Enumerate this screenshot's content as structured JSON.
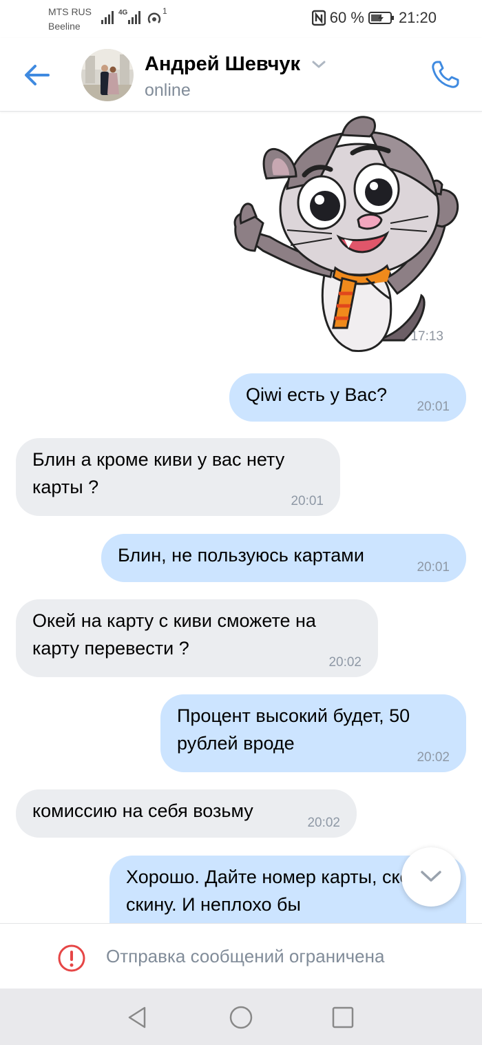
{
  "status_bar": {
    "carrier1": "MTS RUS",
    "carrier2": "Beeline",
    "network": "4G",
    "hotspot_count": "1",
    "battery": "60 %",
    "time": "21:20"
  },
  "header": {
    "name": "Андрей Шевчук",
    "status": "online"
  },
  "sticker": {
    "time": "17:13"
  },
  "messages": [
    {
      "direction": "out",
      "text": "Qiwi есть у Вас?",
      "time": "20:01"
    },
    {
      "direction": "in",
      "text": "Блин а кроме киви у вас нету карты ?",
      "time": "20:01"
    },
    {
      "direction": "out",
      "text": "Блин, не пользуюсь картами",
      "time": "20:01"
    },
    {
      "direction": "in",
      "text": "Окей на карту с киви сможете на карту перевести ?",
      "time": "20:02"
    },
    {
      "direction": "out",
      "text": "Процент высокий будет, 50 рублей вроде",
      "time": "20:02"
    },
    {
      "direction": "in",
      "text": "комиссию на себя возьму",
      "time": "20:02"
    },
    {
      "direction": "out",
      "text": "Хорошо. Дайте номер карты, скоро скину. И неплохо бы",
      "time": ""
    }
  ],
  "footer": {
    "restricted_text": "Отправка сообщений ограничена"
  },
  "colors": {
    "accent": "#3f8ae0",
    "incoming_bubble": "#ebedf0",
    "outgoing_bubble": "#cce4ff",
    "warning": "#e64646"
  },
  "icons": {
    "back": "arrow-left-icon",
    "call": "phone-icon",
    "scroll": "chevron-down-icon",
    "warning": "exclamation-circle-icon",
    "nav_back": "triangle-back-icon",
    "nav_home": "circle-home-icon",
    "nav_recents": "square-recents-icon"
  }
}
